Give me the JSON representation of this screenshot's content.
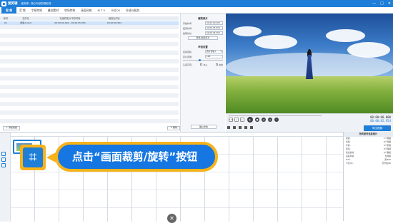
{
  "app": {
    "name": "爱剪辑",
    "subtitle": "爱剪辑 · 随心所欲剪辑影视",
    "window_controls": [
      "—",
      "□",
      "✕"
    ]
  },
  "menu": [
    "视 频",
    "音 频",
    "字幕特效",
    "叠加素材",
    "转场特效",
    "画面风格",
    "M T V",
    "卡拉OK",
    "升级与服务"
  ],
  "table": {
    "headers": [
      "序号",
      "文件名",
      "在最终影片中的时间",
      "裁剪后时长"
    ],
    "rows": [
      [
        "01",
        "视频1.mp4",
        "00:00:00.000 - 00:00:05.954",
        "00:00:05.954"
      ]
    ]
  },
  "clip_panel": {
    "title": "截取原片",
    "fields": [
      {
        "label": "开始时间:",
        "value": "00:00:00.000"
      },
      {
        "label": "结束时间:",
        "value": "00:00:05.954"
      },
      {
        "label": "截取时长:",
        "value": "00:00:05.954"
      }
    ],
    "preview_button": "预览/截取原片",
    "sound_title": "声音设置",
    "sound_fields": [
      {
        "label": "使用音轨:",
        "value": "原片音轨1"
      },
      {
        "label": "原片音量:",
        "value": "100"
      }
    ],
    "head_tail_label": "头尾声音:",
    "fade_in": "淡入",
    "fade_out": "淡出",
    "confirm_button": "确认修改"
  },
  "bottom_left": {
    "add_video": "添加视频",
    "delete": "删除"
  },
  "player": {
    "time_current": "00:00:00.000",
    "time_total": "00:00:05.954",
    "speed_label": "1.0x",
    "export_button": "导出视频"
  },
  "timeline": {
    "clip_caption": "视频1.mp4"
  },
  "callout": {
    "text": "点击“画面裁剪/旋转”按钮",
    "icon": "crop-rotate-icon"
  },
  "right_panel": {
    "title": "所有制作信息统计",
    "rows": [
      {
        "k": "视频:",
        "v": "1个视频"
      },
      {
        "k": "音频:",
        "v": "0个音频"
      },
      {
        "k": "字幕:",
        "v": "0个字幕"
      },
      {
        "k": "转场:",
        "v": "0个转场"
      },
      {
        "k": "叠加素材:",
        "v": "0个叠加"
      },
      {
        "k": "画面风格:",
        "v": "无风格"
      },
      {
        "k": "MTV:",
        "v": "无MTV"
      },
      {
        "k": "卡拉OK:",
        "v": "无卡拉OK"
      }
    ]
  },
  "colors": {
    "brand": "#1e7ed8",
    "callout_bg": "#1677e2",
    "callout_border": "#f7b31a"
  }
}
